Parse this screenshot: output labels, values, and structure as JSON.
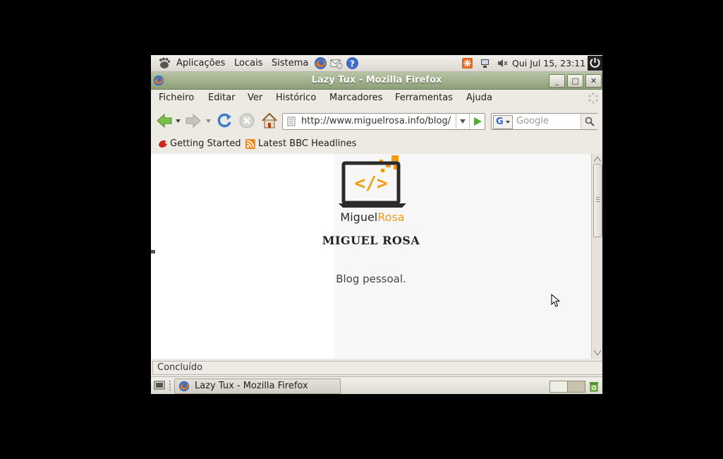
{
  "top_panel": {
    "menus": [
      "Aplicações",
      "Locais",
      "Sistema"
    ],
    "clock": "Qui Jul 15, 23:11"
  },
  "window": {
    "title": "Lazy Tux - Mozilla Firefox"
  },
  "menubar": {
    "items": [
      "Ficheiro",
      "Editar",
      "Ver",
      "Histórico",
      "Marcadores",
      "Ferramentas",
      "Ajuda"
    ]
  },
  "navbar": {
    "url": "http://www.miguelrosa.info/blog/",
    "search_placeholder": "Google"
  },
  "bookmarks": [
    "Getting Started",
    "Latest BBC Headlines"
  ],
  "page": {
    "logo_text_dark": "Miguel",
    "logo_text_accent": "Rosa",
    "logo_code": "</>",
    "site_title": "MIGUEL ROSA",
    "site_description": "Blog pessoal."
  },
  "status": "Concluído",
  "taskbar": {
    "task_label": "Lazy Tux - Mozilla Firefox"
  },
  "colors": {
    "accent_orange": "#f39c12",
    "titlebar": "#a3b28e"
  }
}
